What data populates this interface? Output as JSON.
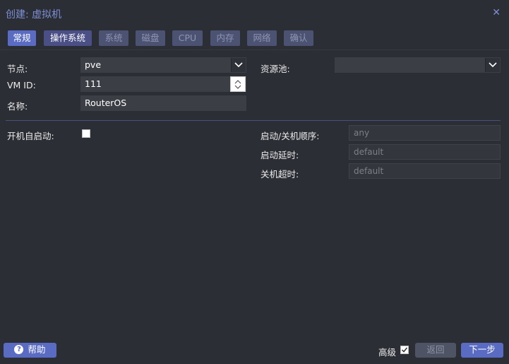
{
  "dialog": {
    "title": "创建: 虚拟机"
  },
  "tabs": [
    {
      "label": "常规",
      "state": "active"
    },
    {
      "label": "操作系统",
      "state": "enabled"
    },
    {
      "label": "系统",
      "state": "disabled"
    },
    {
      "label": "磁盘",
      "state": "disabled"
    },
    {
      "label": "CPU",
      "state": "disabled"
    },
    {
      "label": "内存",
      "state": "disabled"
    },
    {
      "label": "网络",
      "state": "disabled"
    },
    {
      "label": "确认",
      "state": "disabled"
    }
  ],
  "form": {
    "node_label": "节点:",
    "node_value": "pve",
    "vmid_label": "VM ID:",
    "vmid_value": "111",
    "name_label": "名称:",
    "name_value": "RouterOS",
    "pool_label": "资源池:",
    "pool_value": "",
    "onboot_label": "开机自启动:",
    "onboot_checked": false,
    "order_label": "启动/关机顺序:",
    "order_placeholder": "any",
    "startup_delay_label": "启动延时:",
    "startup_delay_placeholder": "default",
    "shutdown_timeout_label": "关机超时:",
    "shutdown_timeout_placeholder": "default"
  },
  "footer": {
    "help_label": "帮助",
    "advanced_label": "高级",
    "advanced_checked": true,
    "back_label": "返回",
    "next_label": "下一步"
  },
  "colors": {
    "accent": "#5a6bc4",
    "title": "#7e8fd6",
    "background": "#2b2e34"
  },
  "icons": [
    "close-icon",
    "chevron-down-icon",
    "spinner-arrows-icon",
    "help-icon",
    "checkmark-icon"
  ]
}
